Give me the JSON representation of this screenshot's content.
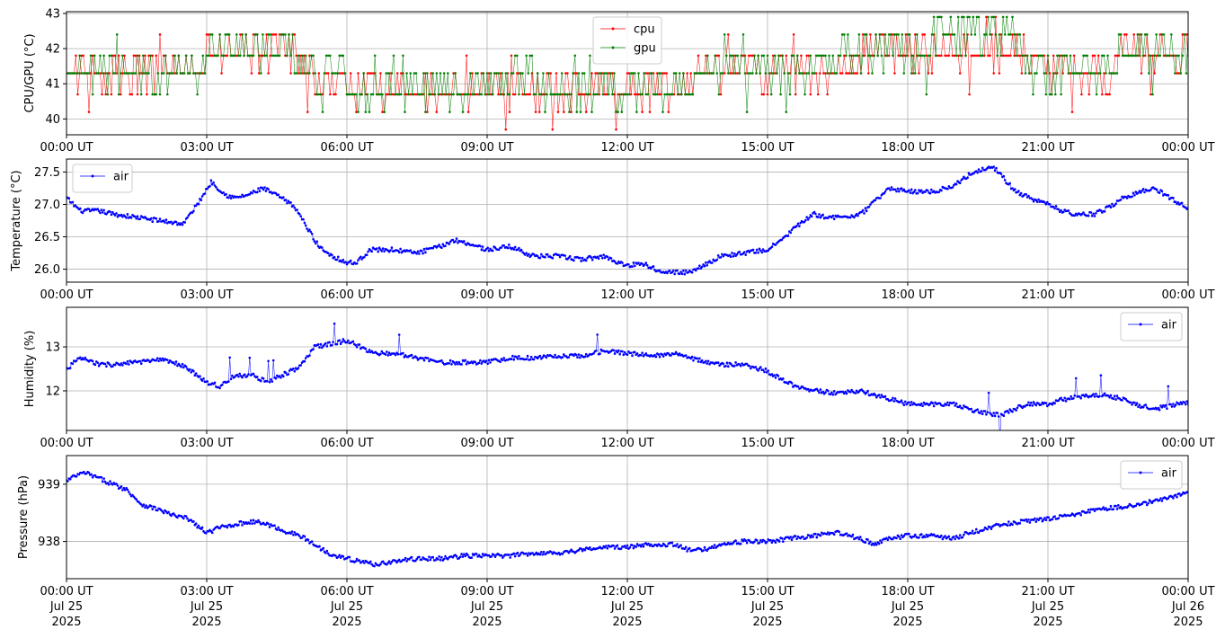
{
  "colors": {
    "cpu": "#ff0000",
    "gpu": "#008000",
    "air": "#0000ff",
    "grid": "#b0b0b0"
  },
  "x_axis": {
    "ticks": [
      "00:00 UT",
      "03:00 UT",
      "06:00 UT",
      "09:00 UT",
      "12:00 UT",
      "15:00 UT",
      "18:00 UT",
      "21:00 UT",
      "00:00 UT"
    ],
    "tick_hours": [
      0,
      3,
      6,
      9,
      12,
      15,
      18,
      21,
      24
    ],
    "date_line": [
      "Jul 25",
      "Jul 25",
      "Jul 25",
      "Jul 25",
      "Jul 25",
      "Jul 25",
      "Jul 25",
      "Jul 25",
      "Jul 26"
    ],
    "year_line": [
      "2025",
      "2025",
      "2025",
      "2025",
      "2025",
      "2025",
      "2025",
      "2025",
      "2025"
    ],
    "range_hours": [
      0,
      24
    ]
  },
  "chart_data": [
    {
      "type": "line",
      "ylabel": "CPU/GPU (°C)",
      "ylim": [
        39.55,
        43.05
      ],
      "yticks": [
        "40",
        "41",
        "42",
        "43"
      ],
      "ytick_values": [
        40,
        41,
        42,
        43
      ],
      "grid": true,
      "legend": "top-center",
      "discrete_levels": [
        39.7,
        40.2,
        40.7,
        41.3,
        41.8,
        42.4,
        42.9
      ],
      "series": [
        {
          "name": "cpu",
          "color": "#ff0000",
          "x_hours": [
            0,
            0.5,
            1,
            1.5,
            2,
            2.5,
            3,
            3.5,
            4,
            4.5,
            5,
            5.3,
            5.5,
            6,
            6.5,
            7,
            7.5,
            8,
            8.5,
            9,
            9.5,
            10,
            10.5,
            11,
            11.5,
            12,
            12.5,
            13,
            13.5,
            14,
            14.5,
            15,
            15.5,
            16,
            16.5,
            17,
            17.5,
            18,
            18.5,
            19,
            19.5,
            20,
            20.5,
            21,
            21.5,
            22,
            22.5,
            23,
            23.5,
            24
          ],
          "y": [
            41.3,
            41.3,
            41.3,
            41.3,
            41.3,
            41.3,
            41.8,
            41.8,
            41.8,
            41.8,
            41.3,
            40.7,
            40.7,
            40.7,
            40.7,
            40.7,
            40.7,
            40.7,
            40.7,
            40.7,
            40.7,
            40.7,
            40.7,
            40.7,
            40.7,
            40.7,
            40.7,
            40.7,
            41.3,
            41.3,
            41.3,
            41.3,
            41.3,
            41.3,
            41.3,
            41.8,
            41.8,
            41.8,
            41.8,
            41.8,
            41.8,
            41.8,
            41.3,
            41.3,
            41.3,
            41.3,
            41.8,
            41.8,
            41.8,
            41.8
          ]
        },
        {
          "name": "gpu",
          "color": "#008000",
          "x_hours": [
            0,
            0.5,
            1,
            1.5,
            2,
            2.5,
            3,
            3.5,
            4,
            4.5,
            5,
            5.3,
            5.5,
            6,
            6.5,
            7,
            7.5,
            8,
            8.5,
            9,
            9.5,
            10,
            10.5,
            11,
            11.5,
            12,
            12.5,
            13,
            13.5,
            14,
            14.5,
            15,
            15.5,
            16,
            16.5,
            17,
            17.5,
            18,
            18.5,
            19,
            19.5,
            20,
            20.5,
            21,
            21.5,
            22,
            22.5,
            23,
            23.5,
            24
          ],
          "y": [
            41.3,
            41.3,
            41.3,
            41.3,
            41.3,
            41.3,
            41.8,
            41.8,
            41.8,
            41.8,
            41.3,
            40.7,
            41.3,
            40.7,
            40.7,
            40.7,
            40.7,
            40.7,
            40.7,
            40.7,
            41.3,
            40.7,
            40.7,
            40.7,
            40.7,
            40.7,
            40.7,
            40.7,
            41.3,
            41.3,
            41.3,
            41.3,
            41.3,
            41.3,
            41.8,
            41.8,
            41.8,
            41.8,
            42.4,
            42.4,
            42.4,
            42.4,
            41.3,
            41.3,
            41.3,
            41.3,
            41.8,
            41.8,
            41.8,
            41.8
          ]
        }
      ]
    },
    {
      "type": "line",
      "ylabel": "Temperature (°C)",
      "ylim": [
        25.8,
        27.7
      ],
      "yticks": [
        "26.0",
        "26.5",
        "27.0",
        "27.5"
      ],
      "ytick_values": [
        26.0,
        26.5,
        27.0,
        27.5
      ],
      "grid": true,
      "legend": "top-left",
      "series": [
        {
          "name": "air",
          "color": "#0000ff",
          "x_hours": [
            0,
            0.3,
            0.7,
            1,
            1.5,
            2,
            2.5,
            2.8,
            3.1,
            3.4,
            3.6,
            3.9,
            4.2,
            4.6,
            4.9,
            5.1,
            5.4,
            5.7,
            6,
            6.2,
            6.5,
            7,
            7.5,
            8,
            8.3,
            8.6,
            9,
            9.5,
            10,
            10.5,
            11,
            11.5,
            12,
            12.3,
            12.6,
            13,
            13.3,
            13.6,
            14,
            14.5,
            15,
            15.3,
            15.6,
            16,
            16.3,
            16.6,
            17,
            17.3,
            17.6,
            18,
            18.3,
            18.6,
            19,
            19.3,
            19.6,
            19.8,
            20,
            20.3,
            20.6,
            21,
            21.3,
            21.6,
            22,
            22.3,
            22.6,
            23,
            23.3,
            23.6,
            24
          ],
          "y": [
            27.1,
            26.9,
            26.9,
            26.85,
            26.8,
            26.75,
            26.7,
            27.0,
            27.35,
            27.15,
            27.1,
            27.15,
            27.25,
            27.1,
            26.95,
            26.7,
            26.35,
            26.2,
            26.1,
            26.1,
            26.3,
            26.3,
            26.25,
            26.35,
            26.45,
            26.4,
            26.3,
            26.35,
            26.2,
            26.2,
            26.15,
            26.2,
            26.05,
            26.1,
            26.0,
            25.95,
            25.95,
            26.05,
            26.2,
            26.25,
            26.3,
            26.45,
            26.65,
            26.85,
            26.8,
            26.8,
            26.85,
            27.05,
            27.25,
            27.2,
            27.2,
            27.2,
            27.3,
            27.45,
            27.55,
            27.6,
            27.45,
            27.2,
            27.1,
            27.0,
            26.9,
            26.85,
            26.85,
            26.95,
            27.1,
            27.2,
            27.25,
            27.1,
            26.95
          ]
        }
      ]
    },
    {
      "type": "line",
      "ylabel": "Humidity (%)",
      "ylim": [
        11.1,
        13.9
      ],
      "yticks": [
        "12",
        "13"
      ],
      "ytick_values": [
        12,
        13
      ],
      "grid": true,
      "legend": "top-right",
      "series": [
        {
          "name": "air",
          "color": "#0000ff",
          "x_hours": [
            0,
            0.3,
            0.7,
            1,
            1.5,
            2,
            2.3,
            2.6,
            3,
            3.3,
            3.6,
            4,
            4.3,
            4.6,
            5,
            5.3,
            5.6,
            6,
            6.3,
            6.6,
            7,
            7.5,
            8,
            8.5,
            9,
            9.5,
            10,
            10.5,
            11,
            11.5,
            12,
            12.5,
            13,
            13.5,
            14,
            14.5,
            15,
            15.3,
            15.6,
            16,
            16.5,
            17,
            17.5,
            18,
            18.5,
            19,
            19.3,
            19.6,
            20,
            20.3,
            20.6,
            21,
            21.3,
            21.6,
            22,
            22.3,
            22.6,
            23,
            23.3,
            23.6,
            24
          ],
          "y": [
            12.5,
            12.75,
            12.6,
            12.6,
            12.65,
            12.7,
            12.65,
            12.5,
            12.2,
            12.1,
            12.35,
            12.35,
            12.2,
            12.35,
            12.55,
            13.0,
            13.05,
            13.15,
            13.0,
            12.85,
            12.85,
            12.75,
            12.65,
            12.65,
            12.65,
            12.75,
            12.75,
            12.8,
            12.8,
            12.9,
            12.85,
            12.8,
            12.85,
            12.7,
            12.6,
            12.6,
            12.45,
            12.25,
            12.1,
            12.0,
            11.95,
            12.0,
            11.85,
            11.7,
            11.7,
            11.7,
            11.6,
            11.5,
            11.45,
            11.6,
            11.7,
            11.7,
            11.8,
            11.85,
            11.9,
            11.9,
            11.8,
            11.65,
            11.6,
            11.65,
            11.75
          ]
        }
      ]
    },
    {
      "type": "line",
      "ylabel": "Pressure (hPa)",
      "ylim": [
        937.35,
        939.5
      ],
      "yticks": [
        "938",
        "939"
      ],
      "ytick_values": [
        938,
        939
      ],
      "grid": true,
      "legend": "top-right",
      "series": [
        {
          "name": "air",
          "color": "#0000ff",
          "x_hours": [
            0,
            0.2,
            0.4,
            0.7,
            1,
            1.3,
            1.6,
            2,
            2.3,
            2.6,
            3,
            3.3,
            3.6,
            4,
            4.3,
            4.6,
            5,
            5.3,
            5.6,
            6,
            6.3,
            6.6,
            7,
            7.5,
            8,
            8.5,
            9,
            9.5,
            10,
            10.5,
            11,
            11.5,
            12,
            12.5,
            13,
            13.3,
            13.6,
            14,
            14.5,
            15,
            15.5,
            16,
            16.5,
            17,
            17.3,
            17.6,
            18,
            18.5,
            19,
            19.3,
            19.6,
            20,
            20.5,
            21,
            21.5,
            22,
            22.5,
            23,
            23.5,
            24
          ],
          "y": [
            939.05,
            939.15,
            939.2,
            939.1,
            939.0,
            938.9,
            938.65,
            938.55,
            938.45,
            938.4,
            938.15,
            938.25,
            938.3,
            938.35,
            938.3,
            938.2,
            938.1,
            937.95,
            937.8,
            937.7,
            937.65,
            937.6,
            937.65,
            937.7,
            937.7,
            937.75,
            937.75,
            937.75,
            937.8,
            937.8,
            937.85,
            937.9,
            937.9,
            937.95,
            937.95,
            937.85,
            937.85,
            937.95,
            938.0,
            938.0,
            938.05,
            938.1,
            938.15,
            938.05,
            937.95,
            938.05,
            938.1,
            938.1,
            938.05,
            938.15,
            938.2,
            938.3,
            938.35,
            938.4,
            938.45,
            938.55,
            938.6,
            938.65,
            938.75,
            938.85
          ]
        }
      ]
    }
  ]
}
